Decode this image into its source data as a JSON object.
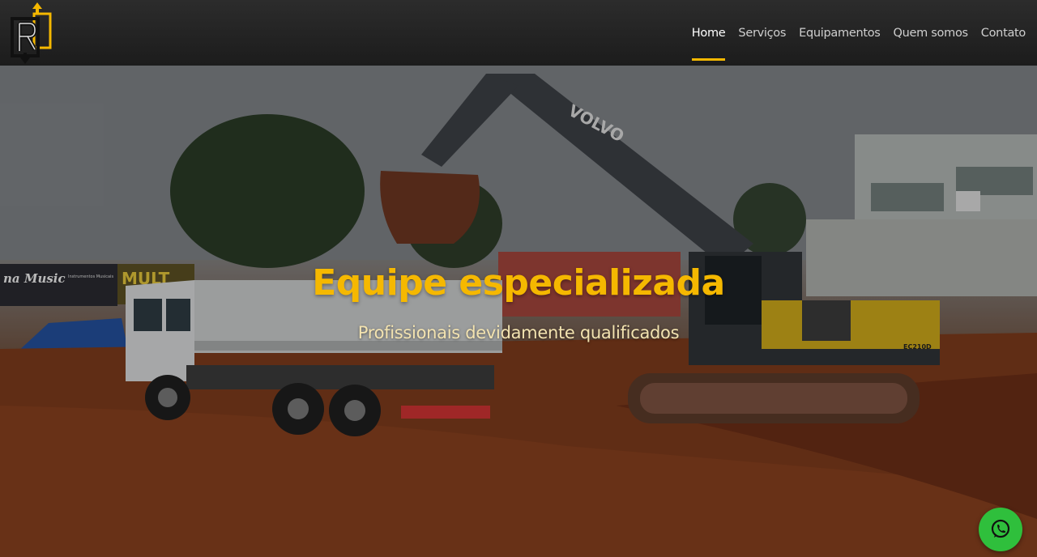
{
  "nav": {
    "items": [
      {
        "label": "Home",
        "active": true
      },
      {
        "label": "Serviços",
        "active": false
      },
      {
        "label": "Equipamentos",
        "active": false
      },
      {
        "label": "Quem somos",
        "active": false
      },
      {
        "label": "Contato",
        "active": false
      }
    ]
  },
  "hero": {
    "title": "Equipe especializada",
    "subtitle": "Profissionais devidamente qualificados",
    "scene": {
      "excavator_brand": "VOLVO",
      "excavator_model": "EC210D",
      "store_sign": "na Music",
      "store_sign_small": "Instrumentos Musicais",
      "store_sign_2": "MULT"
    }
  },
  "colors": {
    "accent": "#f5b800",
    "header_bg": "#222222",
    "whatsapp": "#2fbf3c"
  },
  "icons": {
    "logo": "company-logo-icon",
    "whatsapp": "whatsapp-icon"
  }
}
